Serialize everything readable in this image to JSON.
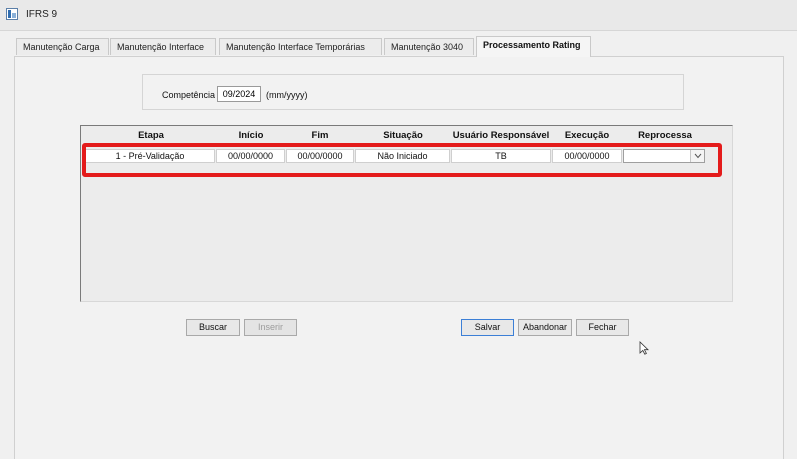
{
  "window": {
    "title": "IFRS 9"
  },
  "tabs": [
    {
      "label": "Manutenção Carga",
      "active": false
    },
    {
      "label": "Manutenção Interface",
      "active": false
    },
    {
      "label": "Manutenção Interface Temporárias",
      "active": false
    },
    {
      "label": "Manutenção 3040",
      "active": false
    },
    {
      "label": "Processamento Rating",
      "active": true
    }
  ],
  "filter": {
    "competencia_label": "Competência",
    "competencia_value": "09/2024",
    "competencia_hint": "(mm/yyyy)"
  },
  "grid": {
    "columns": [
      "Etapa",
      "Início",
      "Fim",
      "Situação",
      "Usuário Responsável",
      "Execução",
      "Reprocessa"
    ],
    "rows": [
      {
        "etapa": "1 - Pré-Validação",
        "inicio": "00/00/0000",
        "fim": "00/00/0000",
        "situacao": "Não Iniciado",
        "usuario": "TB",
        "execucao": "00/00/0000",
        "reprocessa": ""
      }
    ]
  },
  "buttons": {
    "buscar": "Buscar",
    "inserir": "Inserir",
    "salvar": "Salvar",
    "abandonar": "Abandonar",
    "fechar": "Fechar"
  },
  "colors": {
    "highlight": "#e41b1b",
    "default_button_border": "#3c7fd6"
  },
  "icons": {
    "app": "ifrs-app-icon",
    "dropdown": "chevron-down-icon",
    "cursor": "mouse-pointer-icon"
  }
}
